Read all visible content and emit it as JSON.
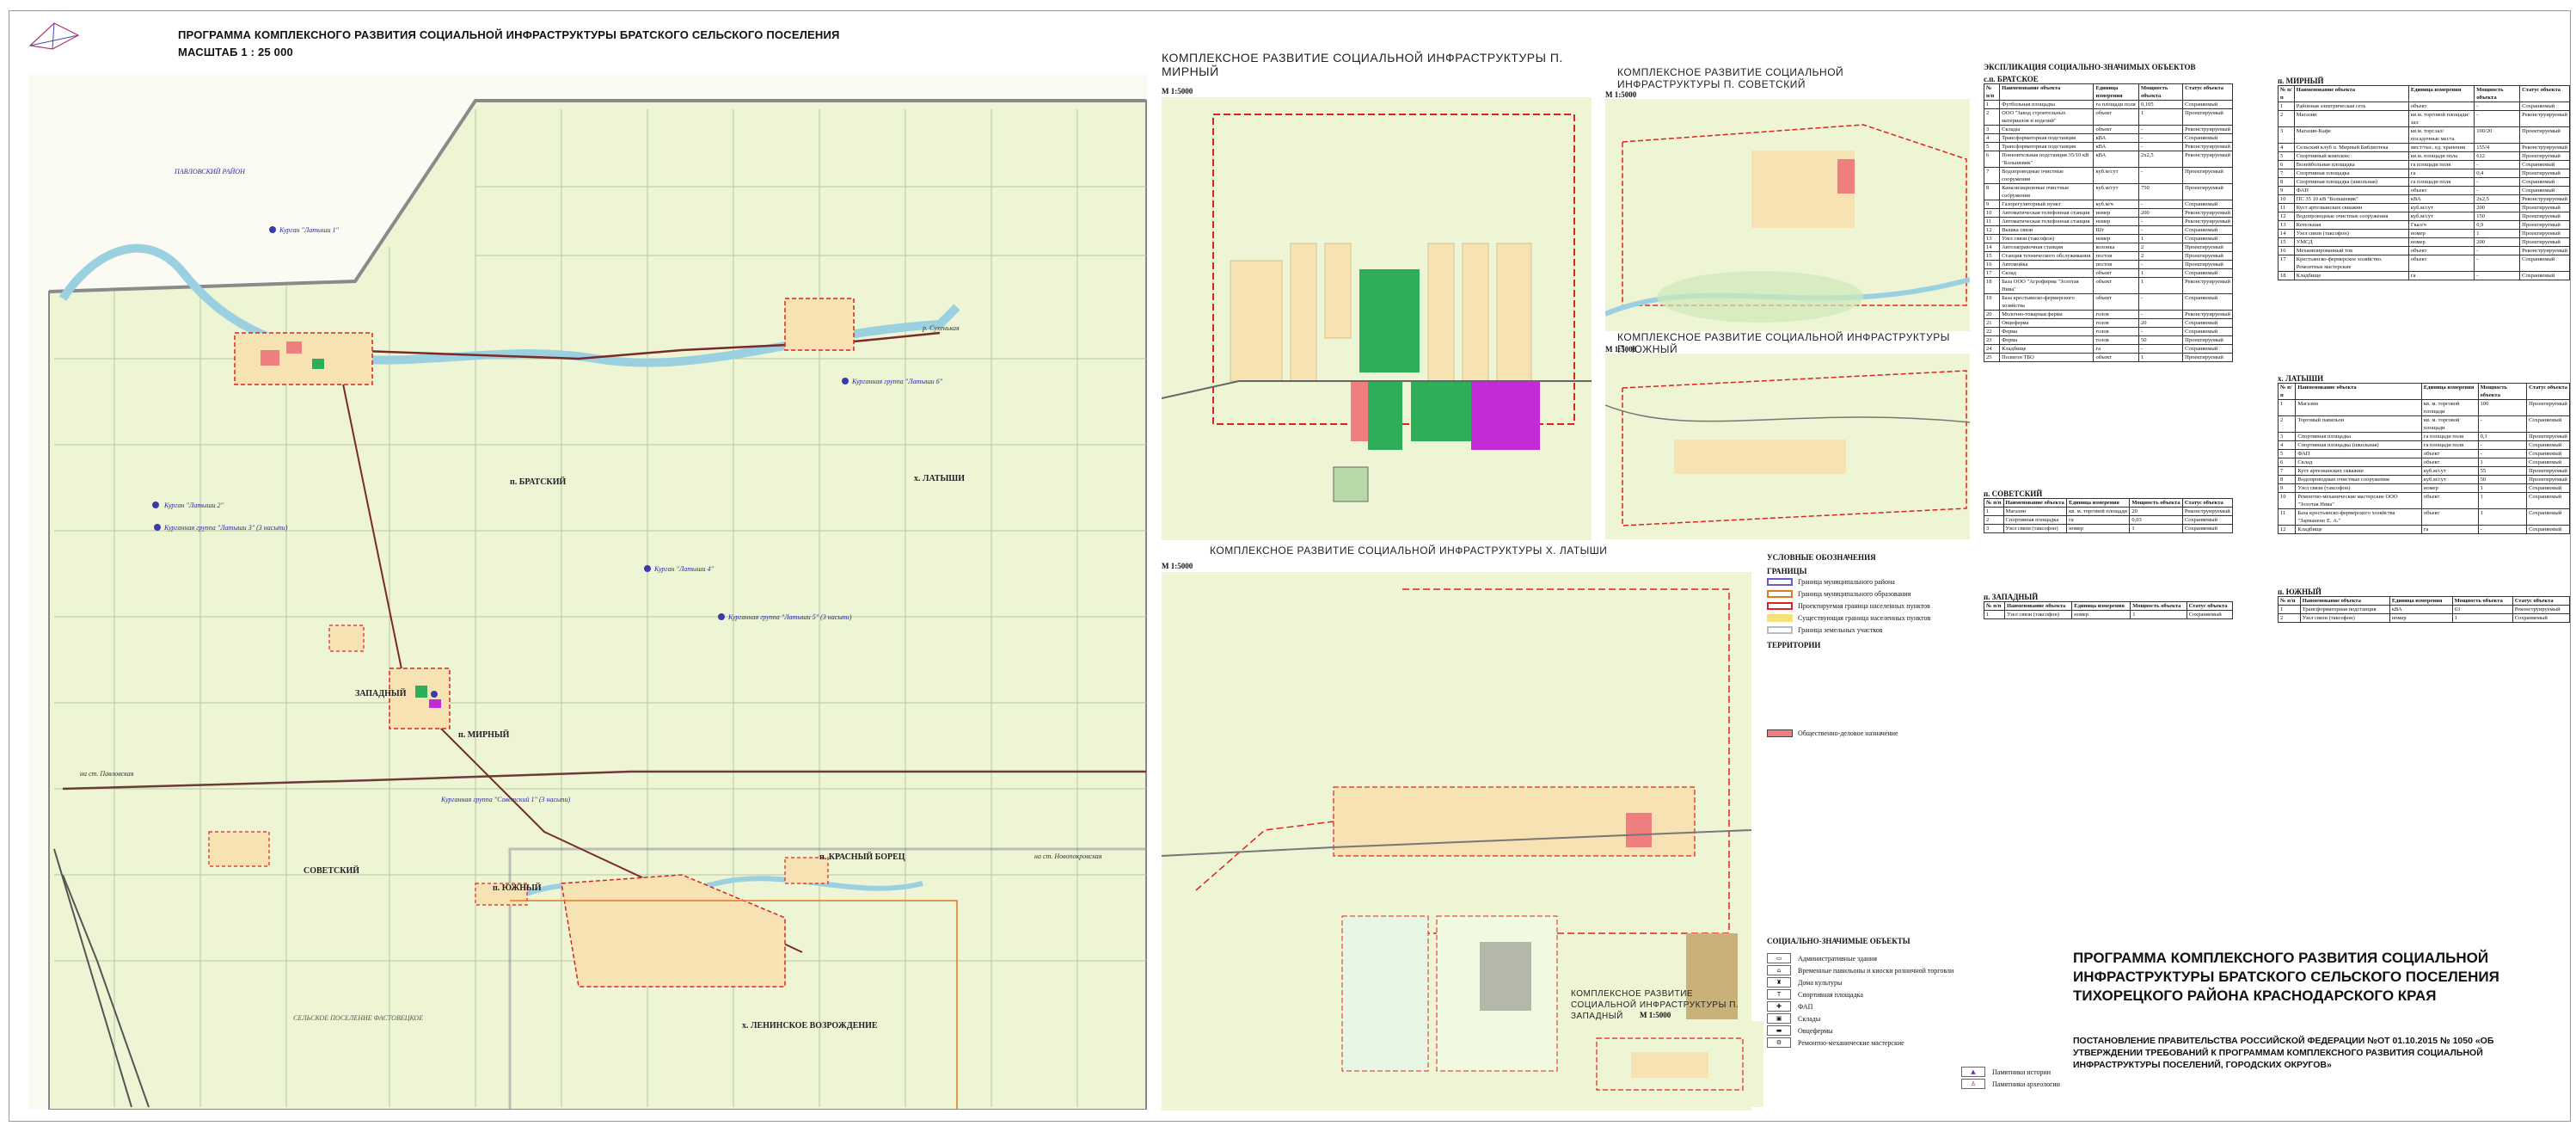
{
  "header": {
    "title": "ПРОГРАММА КОМПЛЕКСНОГО РАЗВИТИЯ СОЦИАЛЬНОЙ ИНФРАСТРУКТУРЫ БРАТСКОГО СЕЛЬСКОГО ПОСЕЛЕНИЯ",
    "scale": "МАСШТАБ 1 : 25 000"
  },
  "main_map": {
    "labels": {
      "pavlovsky": "ПАВЛОВСКИЙ РАЙОН",
      "bratsky": "п. БРАТСКИЙ",
      "latyshi": "х. ЛАТЫШИ",
      "zapadny": "ЗАПАДНЫЙ",
      "mirny": "п. МИРНЫЙ",
      "sovetsky": "СОВЕТСКИЙ",
      "krasny_borets": "п. КРАСНЫЙ БОРЕЦ",
      "yuzhny": "п. ЮЖНЫЙ",
      "leninskoe": "х. ЛЕНИНСКОЕ ВОЗРОЖДЕНИЕ",
      "fastov": "СЕЛЬСКОЕ ПОСЕЛЕНИЕ ФАСТОВЕЦКОЕ",
      "st_pavlovskaya": "на ст. Павловская",
      "st_novopokrovskaya": "на ст. Новопокровская",
      "r_sukhenkaya": "р. Сухенькая",
      "kurgan1": "Курган \"Латыши 1\"",
      "kurgan2": "Курган \"Латыши 2\"",
      "kurgan3": "Курганная группа \"Латыши 3\" (3 насыпи)",
      "kurgan4": "Курган \"Латыши 4\"",
      "kurgan5": "Курганная группа \"Латыши 5\" (3 насыпи)",
      "kurgan6": "Курганная группа \"Латыши 6\"",
      "kurgan7": "Курганная группа \"Советский 1\" (3 насыпи)"
    }
  },
  "panels": {
    "mirny": {
      "title": "КОМПЛЕКСНОЕ РАЗВИТИЕ СОЦИАЛЬНОЙ ИНФРАСТРУКТУРЫ П. МИРНЫЙ",
      "scale": "М 1:5000"
    },
    "sovetsky": {
      "title": "КОМПЛЕКСНОЕ РАЗВИТИЕ СОЦИАЛЬНОЙ ИНФРАСТРУКТУРЫ П. СОВЕТСКИЙ",
      "scale": "М 1:5000"
    },
    "yuzhny": {
      "title": "КОМПЛЕКСНОЕ РАЗВИТИЕ СОЦИАЛЬНОЙ ИНФРАСТРУКТУРЫ П. ЮЖНЫЙ",
      "scale": "М 1:5000"
    },
    "latyshi": {
      "title": "КОМПЛЕКСНОЕ РАЗВИТИЕ СОЦИАЛЬНОЙ ИНФРАСТРУКТУРЫ Х. ЛАТЫШИ",
      "scale": "М 1:5000"
    },
    "zapadny": {
      "title": "КОМПЛЕКСНОЕ РАЗВИТИЕ СОЦИАЛЬНОЙ ИНФРАСТРУКТУРЫ П. ЗАПАДНЫЙ",
      "scale": "М 1:5000"
    }
  },
  "legend": {
    "title": "УСЛОВНЫЕ ОБОЗНАЧЕНИЯ",
    "borders_title": "ГРАНИЦЫ",
    "borders": [
      {
        "label": "Граница муниципального района",
        "color": "#6a5acd"
      },
      {
        "label": "Граница муниципального образования",
        "color": "#e07a20"
      },
      {
        "label": "Проектируемая граница населенных пунктов",
        "color": "#d22"
      },
      {
        "label": "Существующая граница населенных пунктов",
        "color": "#f5e27a"
      },
      {
        "label": "Граница земельных участков",
        "color": "#bbb"
      }
    ],
    "territory_title": "ТЕРРИТОРИИ",
    "territory": [
      {
        "label": "Общественно-деловое назначение",
        "color": "#ef7f7f"
      }
    ],
    "objects_title": "СОЦИАЛЬНО-ЗНАЧИМЫЕ ОБЪЕКТЫ",
    "objects": [
      {
        "label": "Административные здания",
        "icon": "building-icon"
      },
      {
        "label": "Временные павильоны и киоски розничной торговли",
        "icon": "kiosk-icon"
      },
      {
        "label": "Дома культуры",
        "icon": "culture-icon"
      },
      {
        "label": "Спортивная площадка",
        "icon": "sport-icon"
      },
      {
        "label": "ФАП",
        "icon": "medical-icon"
      },
      {
        "label": "Склады",
        "icon": "warehouse-icon"
      },
      {
        "label": "Овцефермы",
        "icon": "farm-icon"
      },
      {
        "label": "Ремонтно-механические мастерские",
        "icon": "workshop-icon"
      }
    ],
    "monuments": [
      {
        "label": "Памятники истории",
        "icon": "monument-icon"
      },
      {
        "label": "Памятники археологии",
        "icon": "archaeology-icon"
      }
    ]
  },
  "explication": {
    "title": "ЭКСПЛИКАЦИЯ СОЦИАЛЬНО-ЗНАЧИМЫХ ОБЪЕКТОВ",
    "headers": [
      "№ п/п",
      "Наименование объекта",
      "Единица измерения",
      "Мощность объекта",
      "Статус объекта"
    ],
    "bratskoe": {
      "name": "с.п. БРАТСКОЕ",
      "rows": [
        [
          "1",
          "Футбольная площадка",
          "га площади поля",
          "0,105",
          "Сохраняемый"
        ],
        [
          "2",
          "ООО \"Завод строительных материалов и изделий\"",
          "объект",
          "1",
          "Проектируемый"
        ],
        [
          "3",
          "Склады",
          "объект",
          "-",
          "Реконструируемый"
        ],
        [
          "4",
          "Трансформаторная подстанция",
          "кВА",
          "-",
          "Сохраняемый"
        ],
        [
          "5",
          "Трансформаторная подстанция",
          "кВА",
          "-",
          "Реконструируемый"
        ],
        [
          "6",
          "Понизительная подстанция 35/10 кВ \"Большевик\"",
          "кВА",
          "2х2,5",
          "Реконструируемый"
        ],
        [
          "7",
          "Водопроводные очистные сооружения",
          "куб.м/сут",
          "-",
          "Проектируемый"
        ],
        [
          "8",
          "Канализационные очистные сооружения",
          "куб.м/сут",
          "750",
          "Проектируемый"
        ],
        [
          "9",
          "Газорегуляторный пункт",
          "куб.м/ч",
          "-",
          "Сохраняемый"
        ],
        [
          "10",
          "Автоматическая телефонная станция",
          "номер",
          "200",
          "Реконструируемый"
        ],
        [
          "11",
          "Автоматическая телефонная станция",
          "номер",
          "-",
          "Реконструируемый"
        ],
        [
          "12",
          "Вышка связи",
          "Шт",
          "-",
          "Сохраняемый"
        ],
        [
          "13",
          "Узел связи (таксофон)",
          "номер",
          "1",
          "Сохраняемый"
        ],
        [
          "14",
          "Автозаправочная станция",
          "колонка",
          "2",
          "Проектируемый"
        ],
        [
          "15",
          "Станция технического обслуживания",
          "постов",
          "2",
          "Проектируемый"
        ],
        [
          "16",
          "Автомойка",
          "постов",
          "-",
          "Проектируемый"
        ],
        [
          "17",
          "Склад",
          "объект",
          "1",
          "Сохраняемый"
        ],
        [
          "18",
          "База ООО \"Агрофирма \"Золотая Нива\"",
          "объект",
          "1",
          "Реконструируемый"
        ],
        [
          "19",
          "База крестьянско-фермерского хозяйства",
          "объект",
          "-",
          "Сохраняемый"
        ],
        [
          "20",
          "Молочно-товарная ферма",
          "голов",
          "-",
          "Реконструируемый"
        ],
        [
          "21",
          "Овцеферма",
          "голов",
          "20",
          "Сохраняемый"
        ],
        [
          "22",
          "Ферма",
          "голов",
          "-",
          "Сохраняемый"
        ],
        [
          "23",
          "Ферма",
          "голов",
          "50",
          "Проектируемый"
        ],
        [
          "24",
          "Кладбище",
          "га",
          "-",
          "Сохраняемый"
        ],
        [
          "25",
          "Полигон ТБО",
          "объект",
          "1",
          "Проектируемый"
        ]
      ]
    },
    "sovetsky": {
      "name": "п. СОВЕТСКИЙ",
      "rows": [
        [
          "1",
          "Магазин",
          "кв. м. торговой площади",
          "20",
          "Реконструируемый"
        ],
        [
          "2",
          "Спортивная площадка",
          "га",
          "0,03",
          "Сохраняемый"
        ],
        [
          "3",
          "Узел связи (таксофон)",
          "номер",
          "1",
          "Сохраняемый"
        ]
      ]
    },
    "zapadny": {
      "name": "п. ЗАПАДНЫЙ",
      "rows": [
        [
          "1",
          "Узел связи (таксофон)",
          "номер",
          "1",
          "Сохраняемый"
        ]
      ]
    },
    "mirny": {
      "name": "п. МИРНЫЙ",
      "rows": [
        [
          "1",
          "Районная электрическая сеть",
          "объект",
          "-",
          "Сохраняемый"
        ],
        [
          "2",
          "Магазин",
          "кв.м. торговой площади/зал",
          "-",
          "Реконструируемый"
        ],
        [
          "3",
          "Магазин-Кафе",
          "кв.м. торг.зал/ посадочные места",
          "100/20",
          "Проектируемый"
        ],
        [
          "4",
          "Сельский клуб п. Мирный Библиотека",
          "мест/тыс. ед. хранения",
          "155/4",
          "Реконструируемый"
        ],
        [
          "5",
          "Спортивный комплекс",
          "кв.м. площади пола",
          "612",
          "Проектируемый"
        ],
        [
          "6",
          "Волейбольная площадка",
          "га площади поля",
          "-",
          "Сохраняемый"
        ],
        [
          "7",
          "Спортивная площадка",
          "га",
          "0,4",
          "Проектируемый"
        ],
        [
          "8",
          "Спортивная площадка (школьная)",
          "га площади поля",
          "-",
          "Сохраняемый"
        ],
        [
          "9",
          "ФАП",
          "объект",
          "-",
          "Сохраняемый"
        ],
        [
          "10",
          "ПС 35 10 кВ \"Большевик\"",
          "кВА",
          "2х2,5",
          "Реконструируемый"
        ],
        [
          "11",
          "Куст артезианских скважин",
          "куб.м/сут",
          "200",
          "Проектируемый"
        ],
        [
          "12",
          "Водопроводные очистные сооружения",
          "куб.м/сут",
          "150",
          "Проектируемый"
        ],
        [
          "13",
          "Котельная",
          "Гкал/ч",
          "0,9",
          "Проектируемый"
        ],
        [
          "14",
          "Узел связи (таксофон)",
          "номер",
          "1",
          "Проектируемый"
        ],
        [
          "15",
          "УМСД",
          "номер",
          "200",
          "Проектируемый"
        ],
        [
          "16",
          "Механизированный ток",
          "объект",
          "-",
          "Реконструируемый"
        ],
        [
          "17",
          "Крестьянско-фермерское хозяйство. Ремонтные мастерские",
          "объект",
          "-",
          "Сохраняемый"
        ],
        [
          "18",
          "Кладбище",
          "га",
          "-",
          "Сохраняемый"
        ]
      ]
    },
    "latyshi": {
      "name": "х. ЛАТЫШИ",
      "rows": [
        [
          "1",
          "Магазин",
          "кв. м. торговой площади",
          "100",
          "Проектируемый"
        ],
        [
          "2",
          "Торговый павильон",
          "кв. м. торговой площади",
          "-",
          "Сохраняемый"
        ],
        [
          "3",
          "Спортивная площадка",
          "га площади поля",
          "0,1",
          "Проектируемый"
        ],
        [
          "4",
          "Спортивная площадка (школьная)",
          "га площади поля",
          "-",
          "Сохраняемый"
        ],
        [
          "5",
          "ФАП",
          "объект",
          "-",
          "Сохраняемый"
        ],
        [
          "6",
          "Склад",
          "объект",
          "1",
          "Сохраняемый"
        ],
        [
          "7",
          "Куст артезианских скважин",
          "куб.м/сут",
          "55",
          "Проектируемый"
        ],
        [
          "8",
          "Водопроводные очистные сооружения",
          "куб.м/сут",
          "50",
          "Проектируемый"
        ],
        [
          "9",
          "Узел связи (таксофон)",
          "номер",
          "1",
          "Сохраняемый"
        ],
        [
          "10",
          "Ремонтно-механические мастерские ООО \"Золотая Нива\"",
          "объект",
          "1",
          "Сохраняемый"
        ],
        [
          "11",
          "База крестьянско-фермерского хозяйства \"Зарманено Е. А.\"",
          "объект",
          "1",
          "Сохраняемый"
        ],
        [
          "12",
          "Кладбище",
          "га",
          "-",
          "Сохраняемый"
        ]
      ]
    },
    "yuzhny": {
      "name": "п. ЮЖНЫЙ",
      "rows": [
        [
          "1",
          "Трансформаторная подстанция",
          "кВА",
          "63",
          "Реконструируемый"
        ],
        [
          "2",
          "Узел связи (таксофон)",
          "номер",
          "1",
          "Сохраняемый"
        ]
      ]
    }
  },
  "footer": {
    "big_title": "ПРОГРАММА КОМПЛЕКСНОГО РАЗВИТИЯ СОЦИАЛЬНОЙ ИНФРАСТРУКТУРЫ БРАТСКОГО СЕЛЬСКОГО ПОСЕЛЕНИЯ ТИХОРЕЦКОГО РАЙОНА КРАСНОДАРСКОГО КРАЯ",
    "decree": "ПОСТАНОВЛЕНИЕ ПРАВИТЕЛЬСТВА РОССИЙСКОЙ ФЕДЕРАЦИИ №ОТ 01.10.2015 № 1050 «ОБ УТВЕРЖДЕНИИ ТРЕБОВАНИЙ К ПРОГРАММАМ КОМПЛЕКСНОГО РАЗВИТИЯ СОЦИАЛЬНОЙ ИНФРАСТРУКТУРЫ ПОСЕЛЕНИЙ, ГОРОДСКИХ ОКРУГОВ»"
  },
  "colors": {
    "field": "#eef5d5",
    "residential": "#f6e2b3",
    "public": "#ef7f7f",
    "green": "#2fae5a",
    "magenta": "#c22bd6",
    "border_red": "#d22",
    "road": "#8a8a8a",
    "water": "#bfe0ea"
  }
}
